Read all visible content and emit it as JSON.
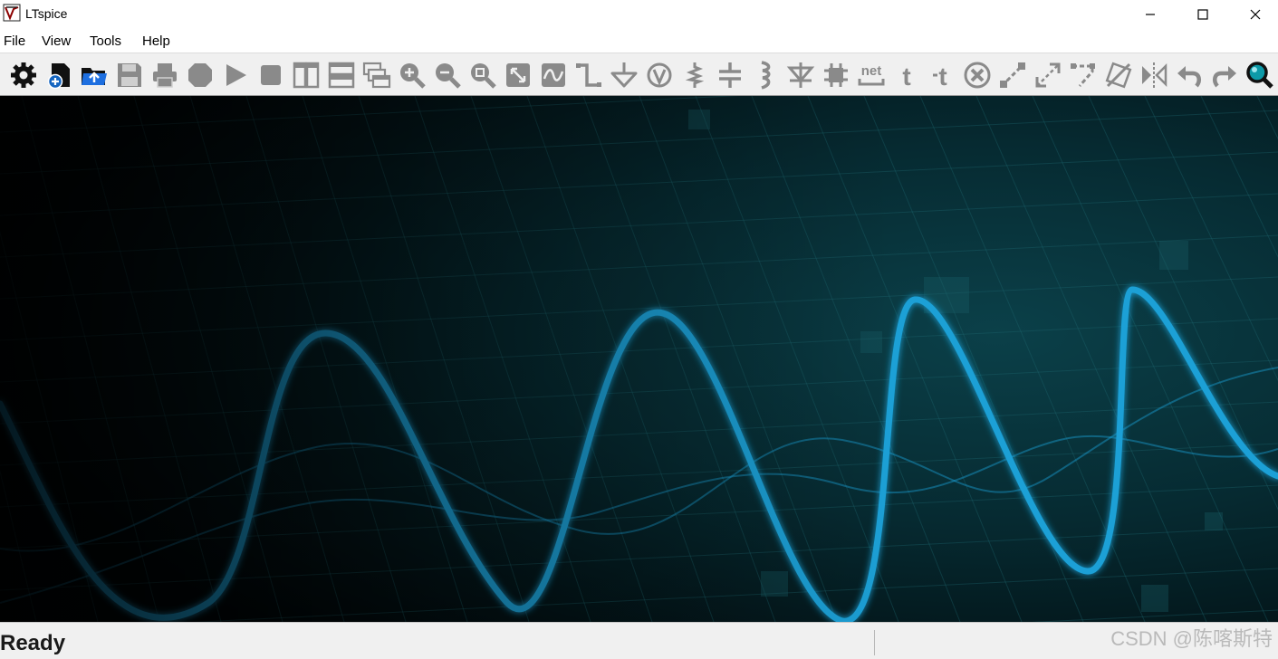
{
  "window": {
    "title": "LTspice"
  },
  "menu": {
    "items": [
      "File",
      "View",
      "Tools",
      "Help"
    ]
  },
  "toolbar": {
    "buttons": [
      {
        "name": "settings-icon"
      },
      {
        "name": "new-schematic-icon"
      },
      {
        "name": "open-icon"
      },
      {
        "name": "save-icon"
      },
      {
        "name": "print-icon"
      },
      {
        "name": "halt-icon"
      },
      {
        "name": "run-icon"
      },
      {
        "name": "stop-icon"
      },
      {
        "name": "tile-vertical-icon"
      },
      {
        "name": "tile-horizontal-icon"
      },
      {
        "name": "cascade-icon"
      },
      {
        "name": "zoom-in-icon"
      },
      {
        "name": "zoom-out-icon"
      },
      {
        "name": "zoom-fit-icon"
      },
      {
        "name": "zoom-area-icon"
      },
      {
        "name": "autorange-icon"
      },
      {
        "name": "wire-icon"
      },
      {
        "name": "ground-icon"
      },
      {
        "name": "node-icon"
      },
      {
        "name": "resistor-icon"
      },
      {
        "name": "capacitor-icon"
      },
      {
        "name": "inductor-icon"
      },
      {
        "name": "diode-icon"
      },
      {
        "name": "component-icon"
      },
      {
        "name": "net-label-icon",
        "label": "net"
      },
      {
        "name": "text-icon",
        "label": "t"
      },
      {
        "name": "spice-directive-icon",
        "label": "t"
      },
      {
        "name": "delete-icon"
      },
      {
        "name": "duplicate-icon"
      },
      {
        "name": "move-icon"
      },
      {
        "name": "drag-icon"
      },
      {
        "name": "rotate-icon"
      },
      {
        "name": "mirror-icon"
      },
      {
        "name": "undo-icon"
      },
      {
        "name": "redo-icon"
      },
      {
        "name": "find-icon"
      }
    ]
  },
  "status": {
    "text": "Ready"
  },
  "watermark": "CSDN @陈喀斯特",
  "colors": {
    "accent": "#1a8fc4",
    "wave": "#1aa0d6",
    "grid": "#0f4b55"
  }
}
